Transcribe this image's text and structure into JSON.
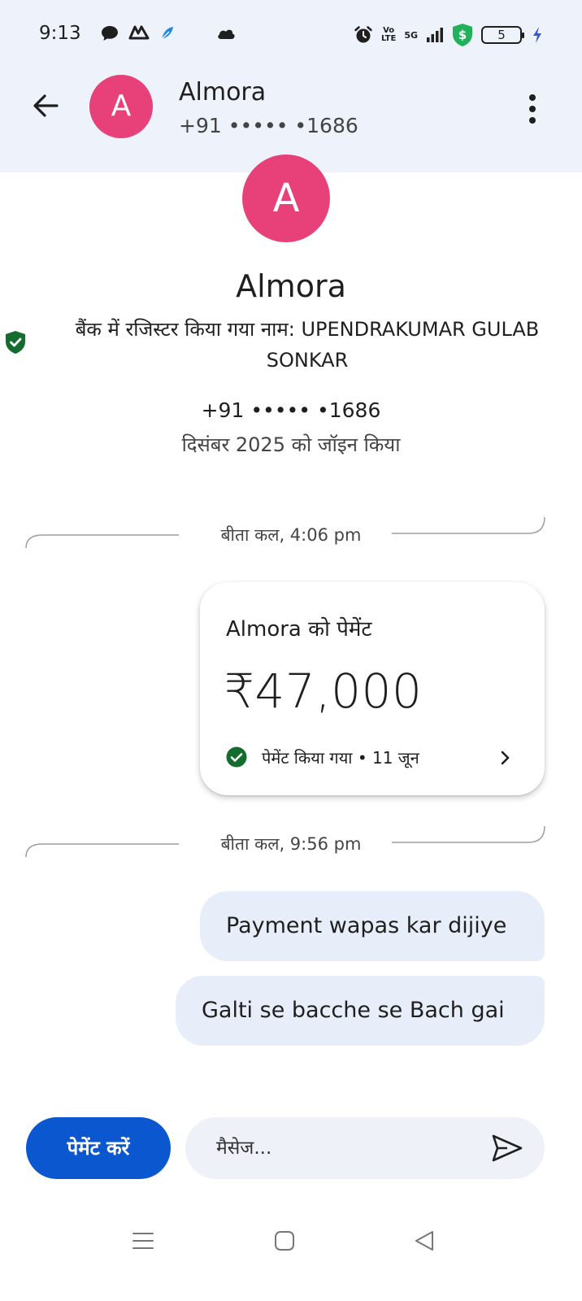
{
  "status_bar": {
    "time": "9:13",
    "battery_level": "5",
    "network": "5G",
    "volte": "Vo LTE",
    "icons": [
      "chat-bubble-icon",
      "app-notification-icon",
      "feather-icon",
      "cloud-icon",
      "alarm-icon",
      "signal-icon",
      "security-shield-icon",
      "battery-icon",
      "charging-bolt-icon"
    ]
  },
  "header": {
    "avatar_letter": "A",
    "name": "Almora",
    "phone": "+91 ••••• •1686"
  },
  "profile": {
    "avatar_letter": "A",
    "name": "Almora",
    "bank_name": "बैंक में रजिस्टर किया गया नाम: UPENDRAKUMAR GULAB SONKAR",
    "phone": "+91 ••••• •1686",
    "joined": "दिसंबर 2025 को जॉइन किया"
  },
  "conversation": {
    "date_divider_1": "बीता कल, 4:06 pm",
    "payment_card": {
      "title": "Almora को पेमेंट",
      "amount": "₹47,000",
      "status": "पेमेंट किया गया • 11 जून"
    },
    "date_divider_2": "बीता कल, 9:56 pm",
    "messages": [
      {
        "text": "Payment wapas kar dijiye"
      },
      {
        "text": "Galti se bacche se Bach gai"
      }
    ]
  },
  "composer": {
    "pay_button_label": "पेमेंट करें",
    "message_placeholder": "मैसेज..."
  },
  "colors": {
    "accent": "#0b57d0",
    "avatar": "#e8417a",
    "header_bg": "#eef3fb",
    "bubble_bg": "#e8eef9",
    "success_green": "#146c2e"
  }
}
